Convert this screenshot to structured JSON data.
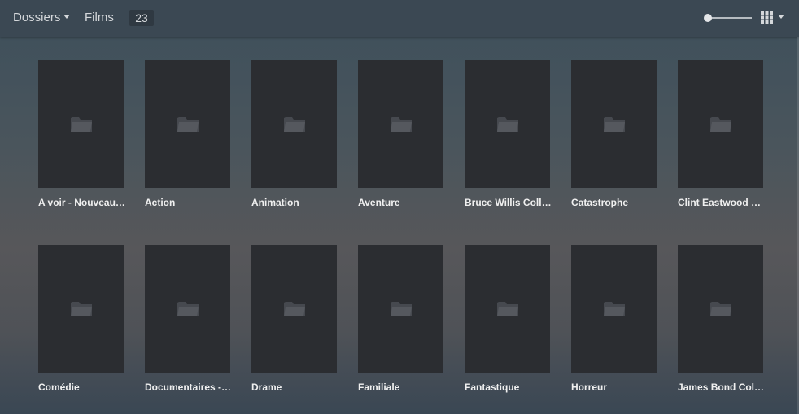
{
  "header": {
    "section_label": "Dossiers",
    "library_label": "Films",
    "item_count": "23",
    "poster_size_slider": {
      "level": 0.0
    },
    "view_mode_icon": "grid-icon"
  },
  "folders": [
    {
      "label": "A voir - Nouveauté…",
      "icon": "folder-icon"
    },
    {
      "label": "Action",
      "icon": "folder-icon"
    },
    {
      "label": "Animation",
      "icon": "folder-icon"
    },
    {
      "label": "Aventure",
      "icon": "folder-icon"
    },
    {
      "label": "Bruce Willis Colle…",
      "icon": "folder-icon"
    },
    {
      "label": "Catastrophe",
      "icon": "folder-icon"
    },
    {
      "label": "Clint Eastwood C…",
      "icon": "folder-icon"
    },
    {
      "label": "Comédie",
      "icon": "folder-icon"
    },
    {
      "label": "Documentaires - …",
      "icon": "folder-icon"
    },
    {
      "label": "Drame",
      "icon": "folder-icon"
    },
    {
      "label": "Familiale",
      "icon": "folder-icon"
    },
    {
      "label": "Fantastique",
      "icon": "folder-icon"
    },
    {
      "label": "Horreur",
      "icon": "folder-icon"
    },
    {
      "label": "James Bond Colle…",
      "icon": "folder-icon"
    }
  ],
  "colors": {
    "header_bg": "#3b4853",
    "poster_bg": "#2b2d31",
    "folder_icon": "#46494f",
    "label_text": "#f0f0f0"
  }
}
